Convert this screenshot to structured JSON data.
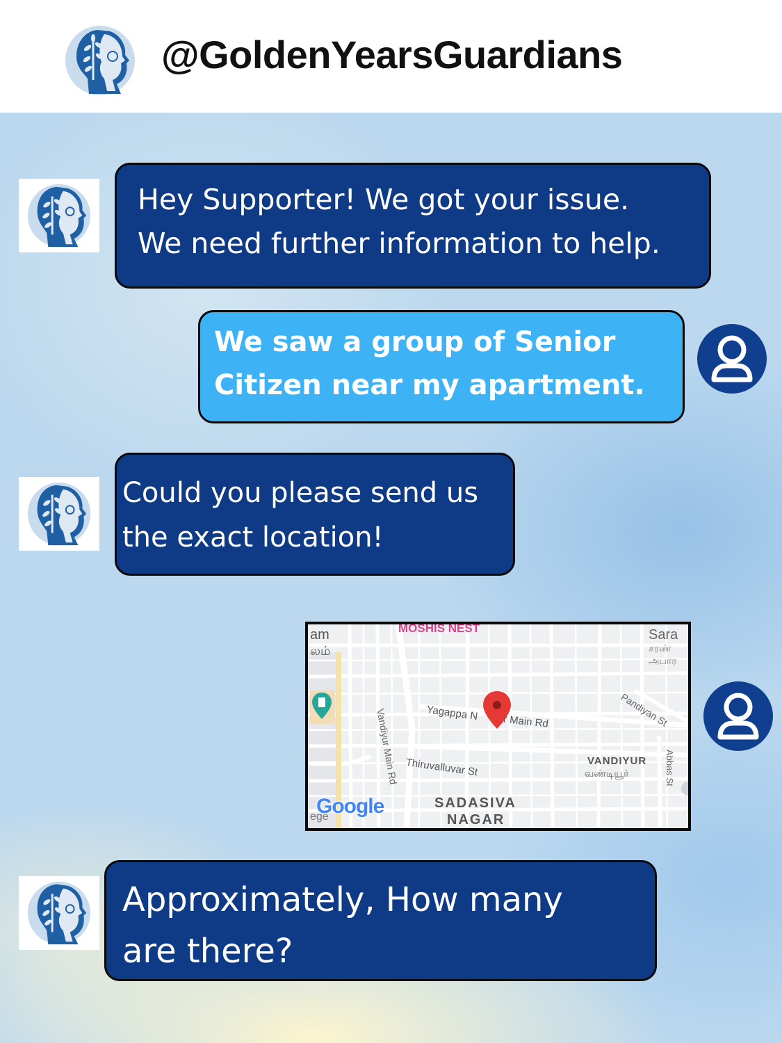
{
  "header": {
    "handle": "@GoldenYearsGuardians",
    "avatar_icon": "elderly-man-tree-logo-icon"
  },
  "colors": {
    "bot_bubble": "#0f3a86",
    "user_bubble": "#3db3f6",
    "user_icon": "#0f3f8e",
    "map_pin": "#e53935"
  },
  "messages": [
    {
      "sender": "bot",
      "lines": [
        "Hey Supporter! We got your issue.",
        "We need further information to help."
      ]
    },
    {
      "sender": "user",
      "lines": [
        "We saw a group of Senior",
        "Citizen near my apartment."
      ]
    },
    {
      "sender": "bot",
      "lines": [
        "Could  you please send us",
        "the exact location!"
      ]
    },
    {
      "sender": "user",
      "type": "map"
    },
    {
      "sender": "bot",
      "lines": [
        "Approximately, How many",
        "are there?"
      ]
    }
  ],
  "map": {
    "top_label": "MOSHIS NEST",
    "left_labels": [
      "am",
      "லம்"
    ],
    "right_labels": [
      "Sara",
      "சரண்",
      "அபார"
    ],
    "roads": [
      "Vandiyur Main Rd",
      "Yagappa N",
      "r Main Rd",
      "Pandiyan St",
      "Thiruvalluvar St",
      "Abbas St"
    ],
    "area_1": [
      "VANDIYUR",
      "வண்டியூர்"
    ],
    "area_2": [
      "SADASIVA",
      "NAGAR"
    ],
    "logo_text": "Google",
    "logo_fragment": [
      "ege"
    ],
    "pin_icon": "map-pin-icon"
  }
}
